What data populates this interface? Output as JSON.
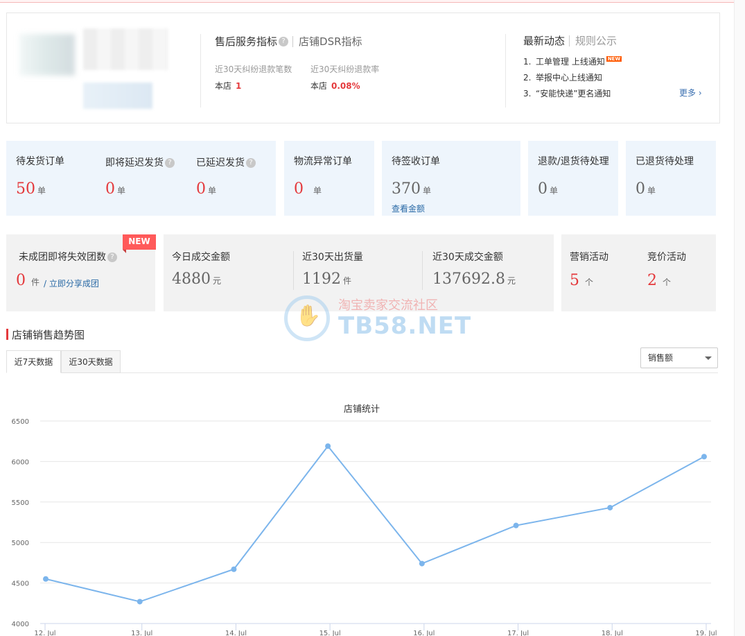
{
  "service": {
    "tab_active": "售后服务指标",
    "tab_inactive": "店铺DSR指标",
    "metrics": [
      {
        "label": "近30天纠纷退款笔数",
        "store_label": "本店",
        "value": "1"
      },
      {
        "label": "近30天纠纷退款率",
        "store_label": "本店",
        "value": "0.08%"
      }
    ]
  },
  "news": {
    "tab_active": "最新动态",
    "tab_inactive": "规则公示",
    "items": [
      {
        "num": "1.",
        "text": "工单管理 上线通知",
        "badge": "NEW"
      },
      {
        "num": "2.",
        "text": "举报中心上线通知"
      },
      {
        "num": "3.",
        "text": "“安能快递”更名通知"
      }
    ],
    "more": "更多 ›"
  },
  "orders": {
    "pending_ship": {
      "label": "待发货订单",
      "value": "50",
      "unit": "单"
    },
    "soon_delayed": {
      "label": "即将延迟发货",
      "value": "0",
      "unit": "单"
    },
    "delayed": {
      "label": "已延迟发货",
      "value": "0",
      "unit": "单"
    },
    "logistics": {
      "label": "物流异常订单",
      "value": "0",
      "unit": "单"
    },
    "pending_sign": {
      "label": "待签收订单",
      "value": "370",
      "unit": "单",
      "link": "查看金额"
    },
    "refund": {
      "label": "退款/退货待处理",
      "value": "0",
      "unit": "单"
    },
    "returned": {
      "label": "已退货待处理",
      "value": "0",
      "unit": "单"
    }
  },
  "group": {
    "badge": "NEW",
    "label": "未成团即将失效团数",
    "value": "0",
    "unit": "件",
    "link": "/ 立即分享成团"
  },
  "sales": {
    "today": {
      "label": "今日成交金额",
      "value": "4880",
      "unit": "元"
    },
    "ship30": {
      "label": "近30天出货量",
      "value": "1192",
      "unit": "件"
    },
    "amount30": {
      "label": "近30天成交金额",
      "value": "137692.8",
      "unit": "元"
    }
  },
  "marketing": {
    "promo": {
      "label": "营销活动",
      "value": "5",
      "unit": "个"
    },
    "bid": {
      "label": "竞价活动",
      "value": "2",
      "unit": "个"
    }
  },
  "watermark": {
    "cn": "淘宝卖家交流社区",
    "en": "TB58.NET"
  },
  "trend": {
    "title": "店铺销售趋势图",
    "tabs": [
      "近7天数据",
      "近30天数据"
    ],
    "select": "销售额"
  },
  "colors": {
    "accent_red": "#e4393c",
    "line_blue": "#7cb5ec",
    "link_blue": "#2a6aa6"
  },
  "chart_data": {
    "type": "line",
    "title": "店铺统计",
    "categories": [
      "12. Jul",
      "13. Jul",
      "14. Jul",
      "15. Jul",
      "16. Jul",
      "17. Jul",
      "18. Jul",
      "19. Jul"
    ],
    "series": [
      {
        "values": [
          4550,
          4270,
          4670,
          6190,
          4740,
          5210,
          5430,
          6060
        ]
      }
    ],
    "yticks": [
      4000,
      4500,
      5000,
      5500,
      6000,
      6500
    ],
    "ylim": [
      4000,
      6500
    ],
    "grid": true
  }
}
